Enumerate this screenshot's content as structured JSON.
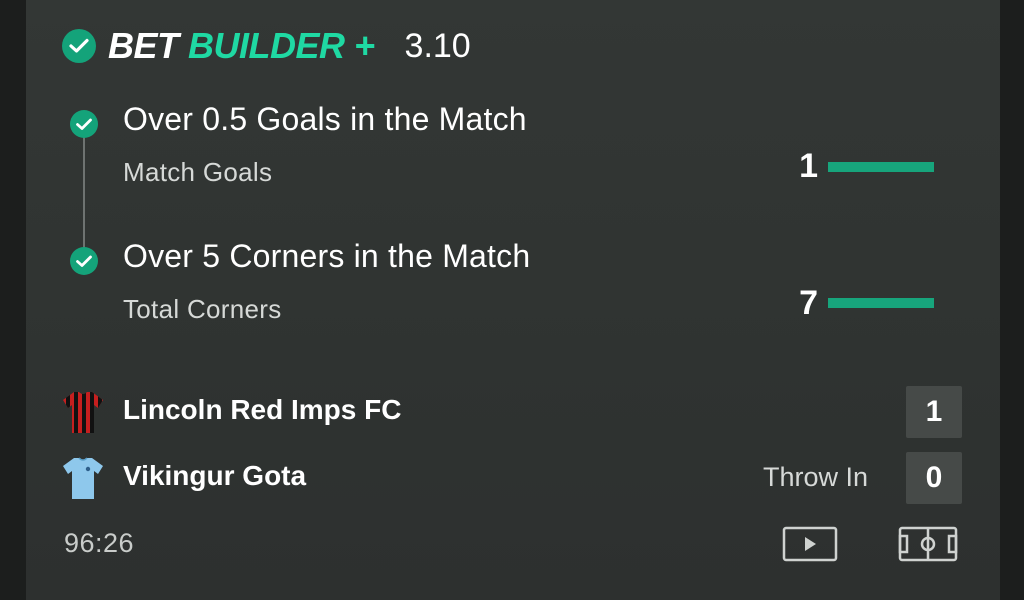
{
  "header": {
    "brand_bet": "BET",
    "brand_builder": "BUILDER +",
    "odds": "3.10",
    "check_icon": "check-icon"
  },
  "legs": [
    {
      "title": "Over 0.5 Goals in the Match",
      "market": "Match Goals",
      "value": "1",
      "progress": 1.0,
      "status": "won"
    },
    {
      "title": "Over 5 Corners in the Match",
      "market": "Total Corners",
      "value": "7",
      "progress": 1.0,
      "status": "won"
    }
  ],
  "match": {
    "home": {
      "name": "Lincoln Red Imps FC",
      "score": "1",
      "kit_icon": "striped-shirt-icon"
    },
    "away": {
      "name": "Vikingur Gota",
      "score": "0",
      "kit_icon": "light-blue-shirt-icon",
      "status": "Throw In"
    },
    "clock": "96:26"
  },
  "controls": {
    "play_icon": "play-video-icon",
    "pitch_icon": "pitch-view-icon"
  },
  "colors": {
    "accent": "#1fd9a3",
    "check": "#14a37a",
    "bar": "#17a57c",
    "card": "#313533"
  }
}
